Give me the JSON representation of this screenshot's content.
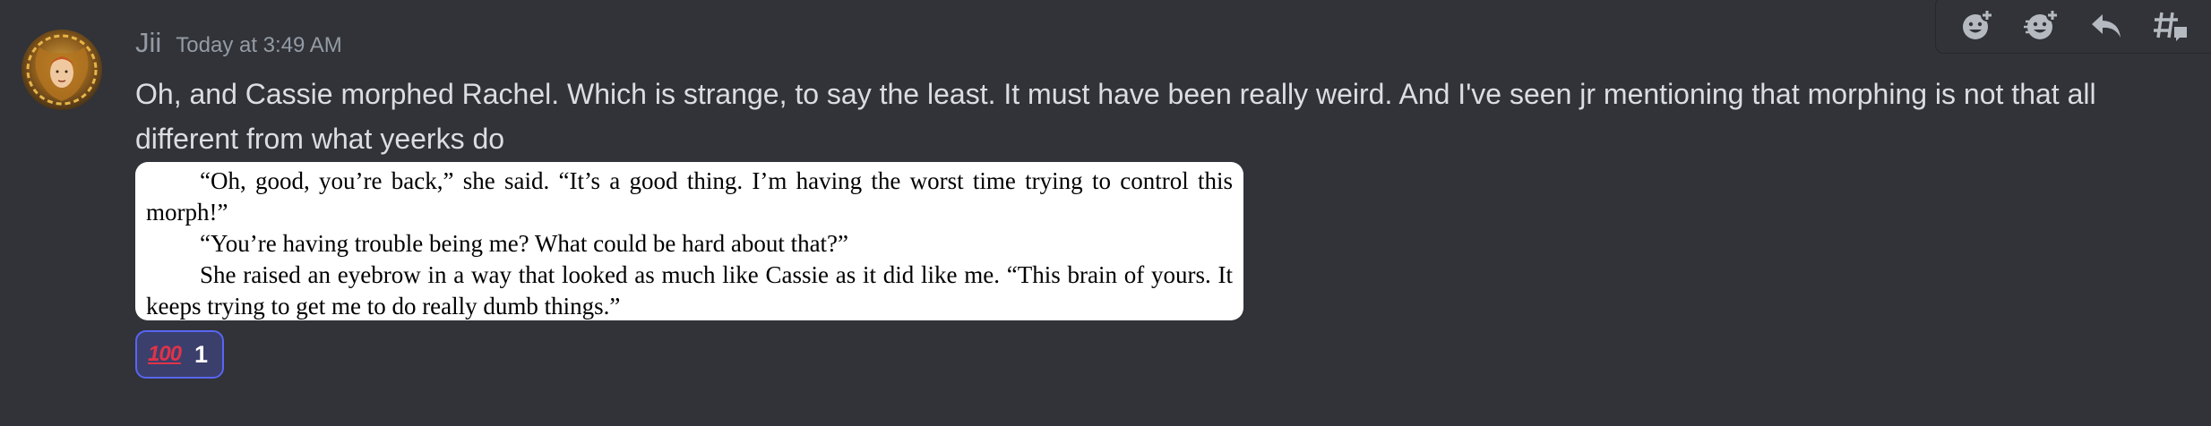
{
  "message": {
    "author": "Jii",
    "timestamp": "Today at 3:49 AM",
    "content": "Oh, and Cassie morphed Rachel. Which is strange, to say the least. It must have been really weird. And I've seen jr mentioning that morphing is not that all different from what yeerks do"
  },
  "attachment": {
    "paragraphs": [
      "“Oh, good, you’re back,” she said. “It’s a good thing. I’m having the worst time trying to control this morph!”",
      "“You’re having trouble being me? What could be hard about that?”",
      "She raised an eyebrow in a way that looked as much like Cassie as it did like me. “This brain of yours. It keeps trying to get me to do really dumb things.”"
    ]
  },
  "reaction": {
    "emoji": "💯",
    "emoji_text": "100",
    "count": "1"
  },
  "toolbar": {
    "icons": [
      "add-reaction-icon",
      "super-reaction-icon",
      "reply-icon",
      "create-thread-icon"
    ]
  },
  "colors": {
    "background": "#313338",
    "username": "#949ba4",
    "text": "#dbdee1",
    "reaction_border": "#5865f2",
    "reaction_bg": "#3b3f6b"
  }
}
